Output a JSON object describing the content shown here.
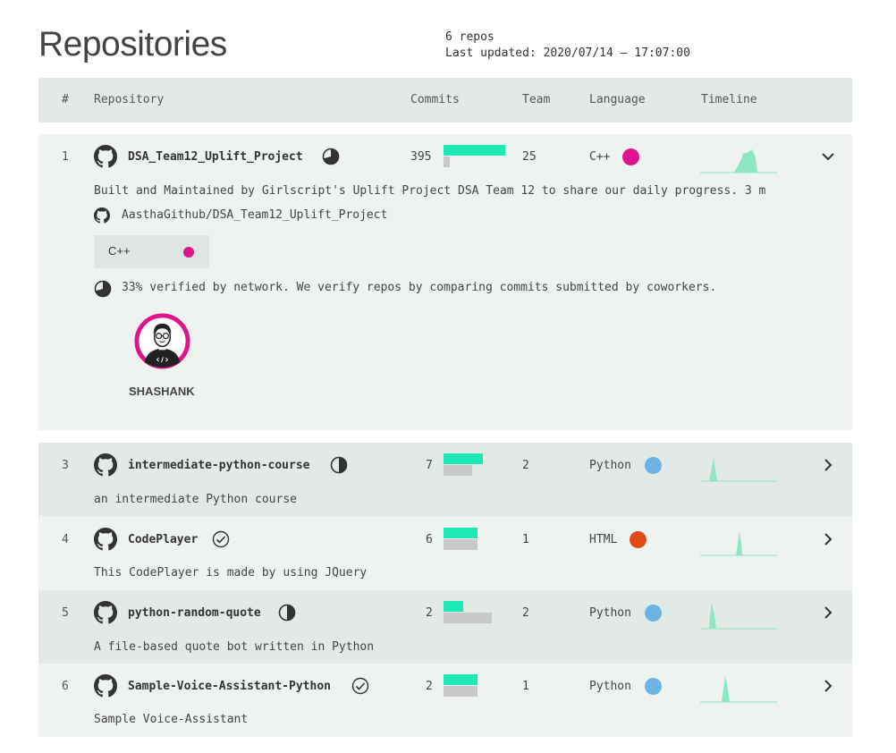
{
  "page": {
    "title": "Repositories",
    "repo_count": "6 repos",
    "last_updated": "Last updated: 2020/07/14 – 17:07:00"
  },
  "columns": {
    "num": "#",
    "repository": "Repository",
    "commits": "Commits",
    "team": "Team",
    "language": "Language",
    "timeline": "Timeline"
  },
  "colors": {
    "cpp": "#e0148a",
    "python": "#6ab4e6",
    "html": "#e24a13",
    "commit_bar": "#1de9b6",
    "team_bar": "#c8c8c8",
    "timeline_fill": "#8de6c4",
    "contributor_ring": "#e0148a"
  },
  "repos": [
    {
      "num": "1",
      "name": "DSA_Team12_Uplift_Project",
      "status_icon": "partial-verified-icon",
      "commits": "395",
      "commits_share": 1.0,
      "team": "25",
      "team_share": 0.1,
      "language": "C++",
      "description": "Built and Maintained by Girlscript's Uplift Project DSA Team 12  to share our daily progress. 3 m",
      "full_name": "AasthaGithub/DSA_Team12_Uplift_Project",
      "language_chip": "C++",
      "verified_text": "33% verified by network. We verify repos by comparing commits submitted by coworkers.",
      "contributor": "SHASHANK",
      "expanded": true
    },
    {
      "num": "3",
      "name": "intermediate-python-course",
      "status_icon": "half-verified-icon",
      "commits": "7",
      "commits_share": 0.8,
      "team": "2",
      "team_share": 0.6,
      "language": "Python",
      "description": "an intermediate Python course"
    },
    {
      "num": "4",
      "name": "CodePlayer",
      "status_icon": "check-circle-icon",
      "commits": "6",
      "commits_share": 0.7,
      "team": "1",
      "team_share": 0.7,
      "language": "HTML",
      "description": "This CodePlayer is made by  using JQuery"
    },
    {
      "num": "5",
      "name": "python-random-quote",
      "status_icon": "half-verified-icon",
      "commits": "2",
      "commits_share": 0.4,
      "team": "2",
      "team_share": 1.0,
      "language": "Python",
      "description": "A file-based quote bot written in Python"
    },
    {
      "num": "6",
      "name": "Sample-Voice-Assistant-Python",
      "status_icon": "check-circle-icon",
      "commits": "2",
      "commits_share": 0.7,
      "team": "1",
      "team_share": 0.7,
      "language": "Python",
      "description": "Sample Voice-Assistant"
    }
  ]
}
